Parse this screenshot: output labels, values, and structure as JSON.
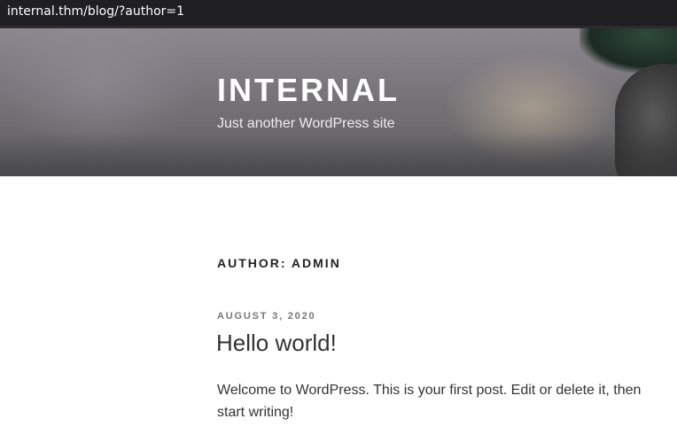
{
  "browser": {
    "url": "internal.thm/blog/?author=1"
  },
  "site": {
    "title": "INTERNAL",
    "description": "Just another WordPress site"
  },
  "archive": {
    "page_title": "Author: admin"
  },
  "posts": [
    {
      "date": "August 3, 2020",
      "title": "Hello world!",
      "excerpt": "Welcome to WordPress. This is your first post. Edit or delete it, then start writing!"
    }
  ]
}
